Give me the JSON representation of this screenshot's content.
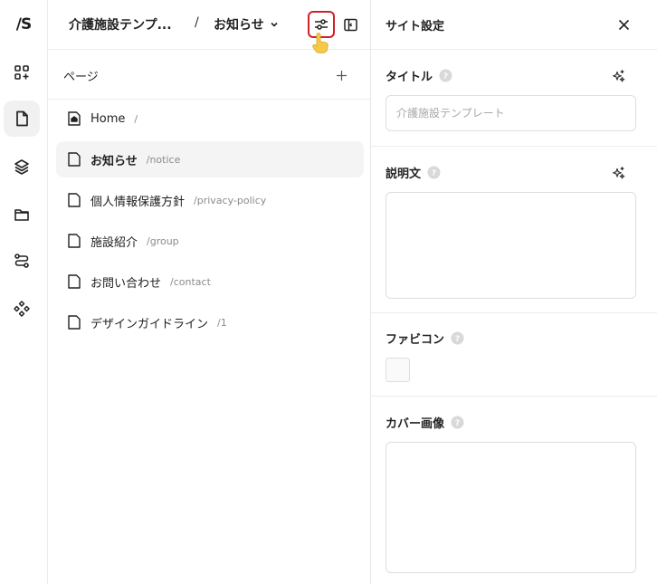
{
  "rail": {
    "logo": "∕S",
    "items": [
      {
        "name": "grid-add-icon"
      },
      {
        "name": "page-icon",
        "active": true
      },
      {
        "name": "layers-icon"
      },
      {
        "name": "folder-icon"
      },
      {
        "name": "route-icon"
      },
      {
        "name": "components-icon"
      }
    ]
  },
  "topbar": {
    "site_name": "介護施設テンプ...",
    "separator": "/",
    "current_page": "お知らせ"
  },
  "pages_panel": {
    "title": "ページ",
    "items": [
      {
        "name": "Home",
        "path": "/",
        "icon": "home-page-icon",
        "selected": false
      },
      {
        "name": "お知らせ",
        "path": "/notice",
        "icon": "page-icon",
        "selected": true
      },
      {
        "name": "個人情報保護方針",
        "path": "/privacy-policy",
        "icon": "page-icon",
        "selected": false
      },
      {
        "name": "施設紹介",
        "path": "/group",
        "icon": "page-icon",
        "selected": false
      },
      {
        "name": "お問い合わせ",
        "path": "/contact",
        "icon": "page-icon",
        "selected": false
      },
      {
        "name": "デザインガイドライン",
        "path": "/1",
        "icon": "page-icon",
        "selected": false
      }
    ]
  },
  "settings_panel": {
    "title": "サイト設定",
    "title_field": {
      "label": "タイトル",
      "value": "",
      "placeholder": "介護施設テンプレート"
    },
    "description_field": {
      "label": "説明文",
      "value": ""
    },
    "favicon_field": {
      "label": "ファビコン"
    },
    "cover_field": {
      "label": "カバー画像"
    }
  },
  "colors": {
    "highlight": "#d0202a",
    "selected_bg": "#f4f4f4",
    "path_text": "#8b8b8b"
  }
}
